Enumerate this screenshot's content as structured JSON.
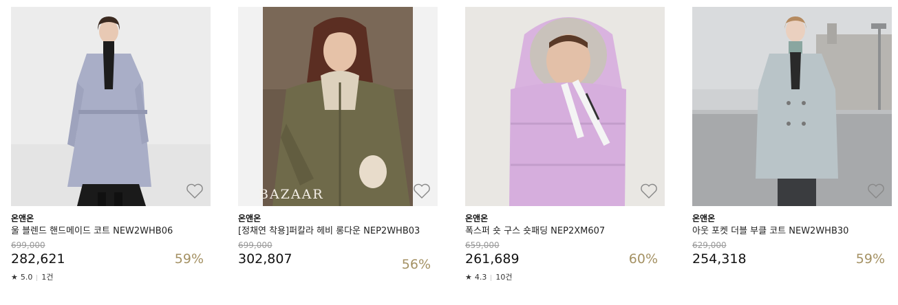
{
  "products": [
    {
      "brand": "온앤온",
      "name": "울 블렌드 핸드메이드 코트 NEW2WHB06",
      "original_price": "699,000",
      "price": "282,621",
      "discount": "59%",
      "rating": "5.0",
      "reviews": "1건",
      "photo_icon": "lavender-coat-photo"
    },
    {
      "brand": "온앤온",
      "name": "[정채연 착용]퍼칼라 헤비 롱다운 NEP2WHB03",
      "original_price": "699,000",
      "price": "302,807",
      "discount": "56%",
      "watermark": "BAZAAR",
      "photo_icon": "khaki-down-photo"
    },
    {
      "brand": "온앤온",
      "name": "폭스퍼 숏 구스 숏패딩 NEP2XM607",
      "original_price": "659,000",
      "price": "261,689",
      "discount": "60%",
      "rating": "4.3",
      "reviews": "10건",
      "photo_icon": "pink-padding-photo"
    },
    {
      "brand": "온앤온",
      "name": "아웃 포켓 더블 부클 코트 NEW2WHB30",
      "original_price": "629,000",
      "price": "254,318",
      "discount": "59%",
      "photo_icon": "grey-coat-photo"
    }
  ],
  "colors": {
    "discount": "#a49163",
    "strike": "#999999"
  }
}
